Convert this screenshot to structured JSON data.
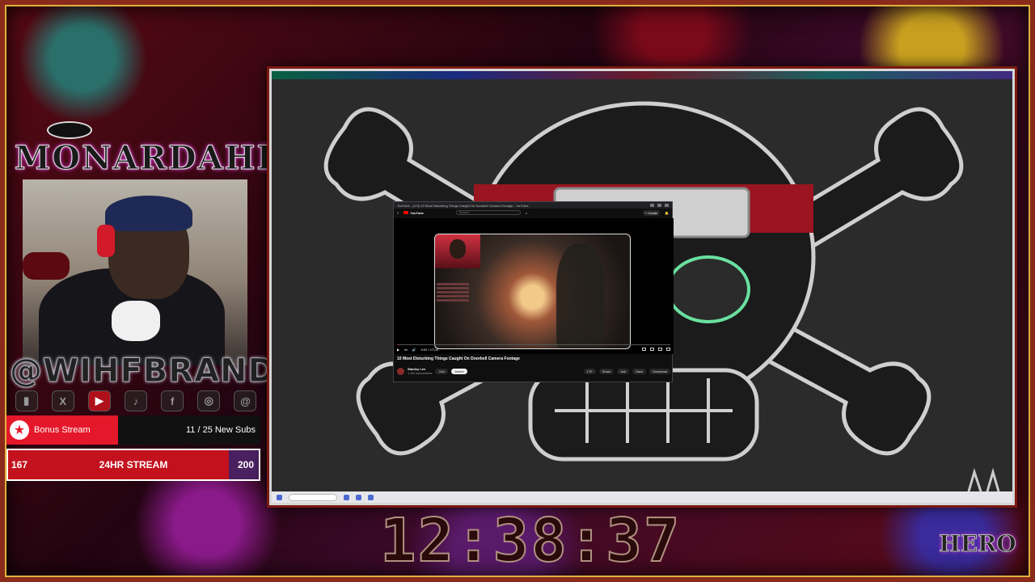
{
  "overlay": {
    "logo_text": "MONARDAHERO",
    "handle": "@WIHFBRAND",
    "socials": [
      "twitch",
      "X",
      "youtube",
      "tiktok",
      "facebook",
      "instagram",
      "threads"
    ],
    "social_glyphs": [
      "▮",
      "X",
      "▶",
      "♪",
      "f",
      "◎",
      "@"
    ]
  },
  "bonus": {
    "label": "Bonus Stream",
    "progress": "11 / 25 New Subs",
    "current": 11,
    "target": 25
  },
  "goal": {
    "start": "167",
    "title": "24HR STREAM",
    "end": "200",
    "fill_fraction": 0.88
  },
  "clock": {
    "time": "12:38:37"
  },
  "corner_logo": "HERO",
  "browser": {
    "window_title": "YouTube - (113) 10 Most Disturbing Things Caught On Doorbell Camera Footage - YouTube",
    "site_label": "YouTube",
    "search_placeholder": "Search",
    "create_label": "+ Create",
    "time": "0:02 / 17:04",
    "video_progress": 0.002,
    "video_title": "10 Most Disturbing Things Caught On Doorbell Camera Footage",
    "channel_name": "Stanley Lee",
    "channel_subs": "1.4M subscribers",
    "join_label": "Join",
    "subscribe_label": "Joined",
    "like_count": "17K",
    "share_label": "Share",
    "ask_label": "Ask",
    "save_label": "Save",
    "download_label": "Download"
  },
  "colors": {
    "accent_red": "#e4182a",
    "goal_purple": "#4a2060",
    "youtube_red": "#ff0000"
  }
}
